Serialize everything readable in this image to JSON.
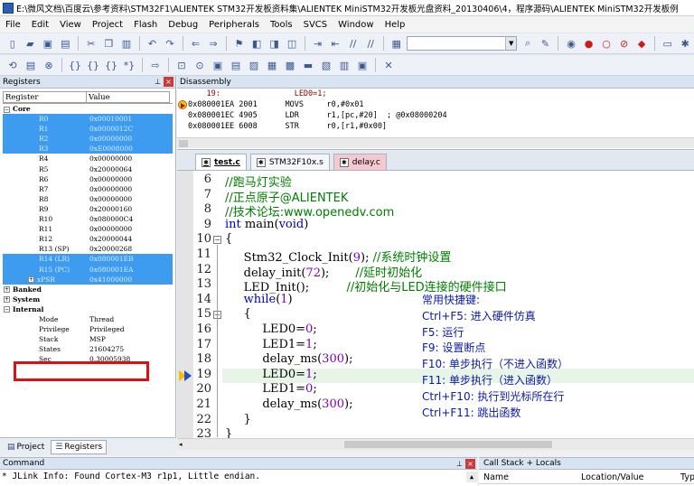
{
  "window": {
    "title": "E:\\微风文档\\百度云\\参考资料\\STM32F1\\ALIENTEK STM32开发板资料集\\ALIENTEK MiniSTM32开发板光盘资料_20130406\\4，程序源码\\ALIENTEK MiniSTM32开发板例"
  },
  "menu": [
    "File",
    "Edit",
    "View",
    "Project",
    "Flash",
    "Debug",
    "Peripherals",
    "Tools",
    "SVCS",
    "Window",
    "Help"
  ],
  "registers_panel": {
    "title": "Registers",
    "col_register": "Register",
    "col_value": "Value",
    "rows": [
      {
        "name": "Core",
        "value": "",
        "kind": "group",
        "toggle": "−"
      },
      {
        "name": "R0",
        "value": "0x00010001",
        "kind": "reg",
        "selected": true
      },
      {
        "name": "R1",
        "value": "0x0000012C",
        "kind": "reg",
        "selected": true
      },
      {
        "name": "R2",
        "value": "0x00000000",
        "kind": "reg",
        "selected": true
      },
      {
        "name": "R3",
        "value": "0xE0008000",
        "kind": "reg",
        "selected": true
      },
      {
        "name": "R4",
        "value": "0x00000000",
        "kind": "reg"
      },
      {
        "name": "R5",
        "value": "0x20000064",
        "kind": "reg"
      },
      {
        "name": "R6",
        "value": "0x00000000",
        "kind": "reg"
      },
      {
        "name": "R7",
        "value": "0x00000000",
        "kind": "reg"
      },
      {
        "name": "R8",
        "value": "0x00000000",
        "kind": "reg"
      },
      {
        "name": "R9",
        "value": "0x20000160",
        "kind": "reg"
      },
      {
        "name": "R10",
        "value": "0x080000C4",
        "kind": "reg"
      },
      {
        "name": "R11",
        "value": "0x00000000",
        "kind": "reg"
      },
      {
        "name": "R12",
        "value": "0x20000044",
        "kind": "reg"
      },
      {
        "name": "R13 (SP)",
        "value": "0x20000268",
        "kind": "reg"
      },
      {
        "name": "R14 (LR)",
        "value": "0x080001EB",
        "kind": "reg",
        "selected": true
      },
      {
        "name": "R15 (PC)",
        "value": "0x080001EA",
        "kind": "reg",
        "selected": true
      },
      {
        "name": "xPSR",
        "value": "0x41000000",
        "kind": "reg",
        "selected": true,
        "toggle": "+"
      },
      {
        "name": "Banked",
        "value": "",
        "kind": "group",
        "toggle": "+"
      },
      {
        "name": "System",
        "value": "",
        "kind": "group",
        "toggle": "+"
      },
      {
        "name": "Internal",
        "value": "",
        "kind": "group",
        "toggle": "−"
      },
      {
        "name": "Mode",
        "value": "Thread",
        "kind": "sub"
      },
      {
        "name": "Privilege",
        "value": "Privileged",
        "kind": "sub"
      },
      {
        "name": "Stack",
        "value": "MSP",
        "kind": "sub"
      },
      {
        "name": "States",
        "value": "21604275",
        "kind": "sub"
      },
      {
        "name": "Sec",
        "value": "0.30005938",
        "kind": "sub"
      }
    ],
    "tab_project": "Project",
    "tab_registers": "Registers"
  },
  "disassembly": {
    "title": "Disassembly",
    "lines": [
      {
        "text": "    19:                LED0=1;",
        "kind": "src"
      },
      {
        "text": "0x080001EA 2001      MOVS     r0,#0x01",
        "kind": "cur"
      },
      {
        "text": "0x080001EC 4905      LDR      r1,[pc,#20]  ; @0x08000204",
        "kind": "asm"
      },
      {
        "text": "0x080001EE 6008      STR      r0,[r1,#0x00]",
        "kind": "asm"
      }
    ]
  },
  "editor_tabs": [
    {
      "label": "test.c",
      "active": true,
      "style": "active"
    },
    {
      "label": "STM32F10x.s",
      "active": false,
      "style": "normal"
    },
    {
      "label": "delay.c",
      "active": false,
      "style": "pink"
    }
  ],
  "code_lines": [
    {
      "num": "6",
      "html": "<span class=\"cm\">//跑马灯实验</span>"
    },
    {
      "num": "7",
      "html": "<span class=\"cm\">//正点原子@ALIENTEK</span>"
    },
    {
      "num": "8",
      "html": "<span class=\"cm\">//技术论坛:www.openedv.com</span>"
    },
    {
      "num": "9",
      "html": "<span class=\"kw\">int</span> main(<span class=\"kw\">void</span>)"
    },
    {
      "num": "10",
      "html": "{",
      "fold": "−"
    },
    {
      "num": "11",
      "html": "     Stm32_Clock_Init(<span class=\"num\">9</span>); <span class=\"cm\">//系统时钟设置</span>"
    },
    {
      "num": "12",
      "html": "     delay_init(<span class=\"num\">72</span>);       <span class=\"cm\">//延时初始化</span>"
    },
    {
      "num": "13",
      "html": "     LED_Init();          <span class=\"cm\">//初始化与LED连接的硬件接口</span>"
    },
    {
      "num": "14",
      "html": "     <span class=\"kw\">while</span>(<span class=\"num\">1</span>)"
    },
    {
      "num": "15",
      "html": "     {",
      "fold": "−"
    },
    {
      "num": "16",
      "html": "          LED0=<span class=\"num\">0</span>;"
    },
    {
      "num": "17",
      "html": "          LED1=<span class=\"num\">1</span>;"
    },
    {
      "num": "18",
      "html": "          delay_ms(<span class=\"num\">300</span>);"
    },
    {
      "num": "19",
      "html": "          LED0=<span class=\"num\">1</span>;",
      "current": true
    },
    {
      "num": "20",
      "html": "          LED1=<span class=\"num\">0</span>;"
    },
    {
      "num": "21",
      "html": "          delay_ms(<span class=\"num\">300</span>);"
    },
    {
      "num": "22",
      "html": "     }"
    },
    {
      "num": "23",
      "html": "}"
    }
  ],
  "shortcut_tips": [
    "常用快捷键:",
    "Ctrl+F5: 进入硬件仿真",
    "F5:  运行",
    "F9:  设置断点",
    "F10:  单步执行（不进入函数）",
    "F11:  单步执行（进入函数）",
    "Ctrl+F10:  执行到光标所在行",
    "Ctrl+F11:  跳出函数"
  ],
  "command_panel": {
    "title": "Command",
    "line": "* JLink Info: Found Cortex-M3 r1p1, Little endian."
  },
  "callstack_panel": {
    "title": "Call Stack + Locals",
    "col_name": "Name",
    "col_location": "Location/Value",
    "col_type": "Typ"
  },
  "colors": {
    "selection": "#3d9cf0",
    "highlight_box": "#e01010",
    "tips_text": "#0a1aa8",
    "comment": "#008000"
  }
}
